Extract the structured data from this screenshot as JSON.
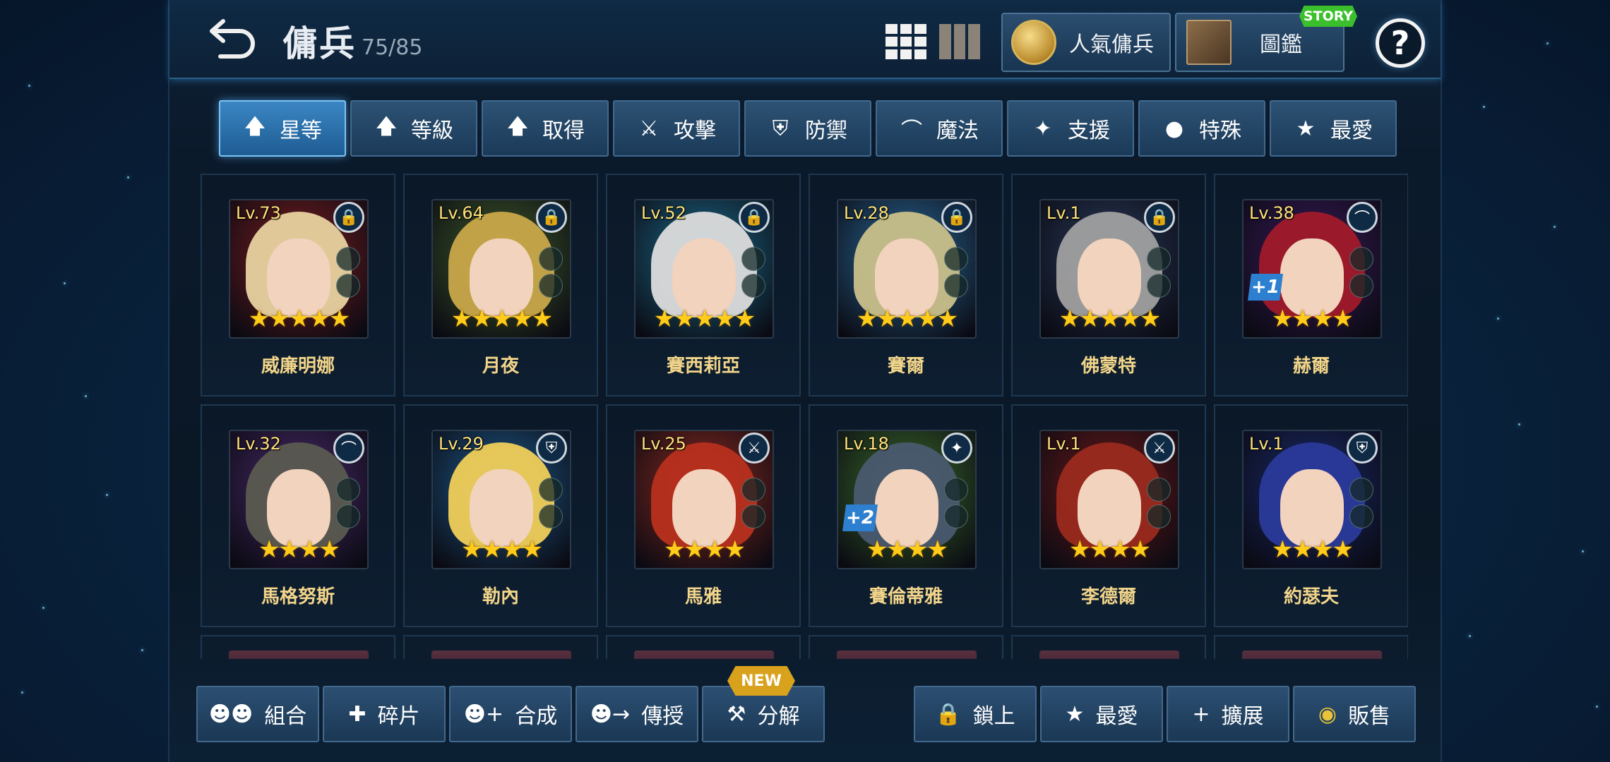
{
  "header": {
    "title": "傭兵",
    "count": "75/85",
    "popular_label": "人氣傭兵",
    "book_label": "圖鑑",
    "story_badge": "STORY",
    "help": "?"
  },
  "filters": [
    {
      "label": "星等",
      "icon": "arrow-up-icon",
      "glyph": "🡅",
      "active": true
    },
    {
      "label": "等級",
      "icon": "arrow-up-icon",
      "glyph": "🡅",
      "active": false
    },
    {
      "label": "取得",
      "icon": "arrow-up-icon",
      "glyph": "🡅",
      "active": false
    },
    {
      "label": "攻擊",
      "icon": "sword-icon",
      "glyph": "⚔",
      "active": false
    },
    {
      "label": "防禦",
      "icon": "shield-icon",
      "glyph": "⛨",
      "active": false
    },
    {
      "label": "魔法",
      "icon": "wizard-hat-icon",
      "glyph": "⌒",
      "active": false
    },
    {
      "label": "支援",
      "icon": "support-icon",
      "glyph": "✦",
      "active": false
    },
    {
      "label": "特殊",
      "icon": "slime-icon",
      "glyph": "●",
      "active": false
    },
    {
      "label": "最愛",
      "icon": "star-icon",
      "glyph": "★",
      "active": false
    }
  ],
  "heroes": [
    {
      "name": "威廉明娜",
      "level": "Lv.73",
      "stars": 5,
      "corner": "lock",
      "plus": "",
      "hair": "#e8d2a0",
      "bg": "#7a1e20"
    },
    {
      "name": "月夜",
      "level": "Lv.64",
      "stars": 5,
      "corner": "lock",
      "plus": "",
      "hair": "#c9a84a",
      "bg": "#3f5a2a"
    },
    {
      "name": "賽西莉亞",
      "level": "Lv.52",
      "stars": 5,
      "corner": "lock",
      "plus": "",
      "hair": "#dcdcdc",
      "bg": "#1c6a8a"
    },
    {
      "name": "賽爾",
      "level": "Lv.28",
      "stars": 5,
      "corner": "lock",
      "plus": "",
      "hair": "#c9c08a",
      "bg": "#2a6a9a"
    },
    {
      "name": "佛蒙特",
      "level": "Lv.1",
      "stars": 5,
      "corner": "lock",
      "plus": "",
      "hair": "#a0a0a0",
      "bg": "#2a3a5a"
    },
    {
      "name": "赫爾",
      "level": "Lv.38",
      "stars": 4,
      "corner": "magic",
      "plus": "+1",
      "hair": "#a01a2a",
      "bg": "#3a1a5a"
    },
    {
      "name": "馬格努斯",
      "level": "Lv.32",
      "stars": 4,
      "corner": "magic",
      "plus": "",
      "hair": "#5a5a50",
      "bg": "#4a2a6a"
    },
    {
      "name": "勒內",
      "level": "Lv.29",
      "stars": 4,
      "corner": "defense",
      "plus": "",
      "hair": "#f0cf5a",
      "bg": "#1e5a8a"
    },
    {
      "name": "馬雅",
      "level": "Lv.25",
      "stars": 4,
      "corner": "attack",
      "plus": "",
      "hair": "#b8301e",
      "bg": "#8a2a20"
    },
    {
      "name": "賽倫蒂雅",
      "level": "Lv.18",
      "stars": 4,
      "corner": "support",
      "plus": "+2",
      "hair": "#4a5a70",
      "bg": "#3a6a2a"
    },
    {
      "name": "李德爾",
      "level": "Lv.1",
      "stars": 4,
      "corner": "attack",
      "plus": "",
      "hair": "#9a2a1e",
      "bg": "#6a1a1a"
    },
    {
      "name": "約瑟夫",
      "level": "Lv.1",
      "stars": 4,
      "corner": "defense",
      "plus": "",
      "hair": "#2a3a9a",
      "bg": "#1a2a6a"
    }
  ],
  "bottom": {
    "new_badge": "NEW",
    "left": [
      {
        "label": "組合",
        "icon": "team-icon",
        "glyph": "☻☻"
      },
      {
        "label": "碎片",
        "icon": "puzzle-icon",
        "glyph": "✚"
      },
      {
        "label": "合成",
        "icon": "merge-icon",
        "glyph": "☻+"
      },
      {
        "label": "傳授",
        "icon": "transfer-icon",
        "glyph": "☻→"
      },
      {
        "label": "分解",
        "icon": "hammer-icon",
        "glyph": "⚒"
      }
    ],
    "right": [
      {
        "label": "鎖上",
        "icon": "lock-icon",
        "glyph": "🔒"
      },
      {
        "label": "最愛",
        "icon": "star-icon",
        "glyph": "★"
      },
      {
        "label": "擴展",
        "icon": "plus-icon",
        "glyph": "+"
      },
      {
        "label": "販售",
        "icon": "coin-icon",
        "glyph": "◉"
      }
    ]
  },
  "colors": {
    "accent": "#3b86c3",
    "star": "#ffcc1a",
    "name": "#f2d58a",
    "level": "#ffe27a"
  }
}
